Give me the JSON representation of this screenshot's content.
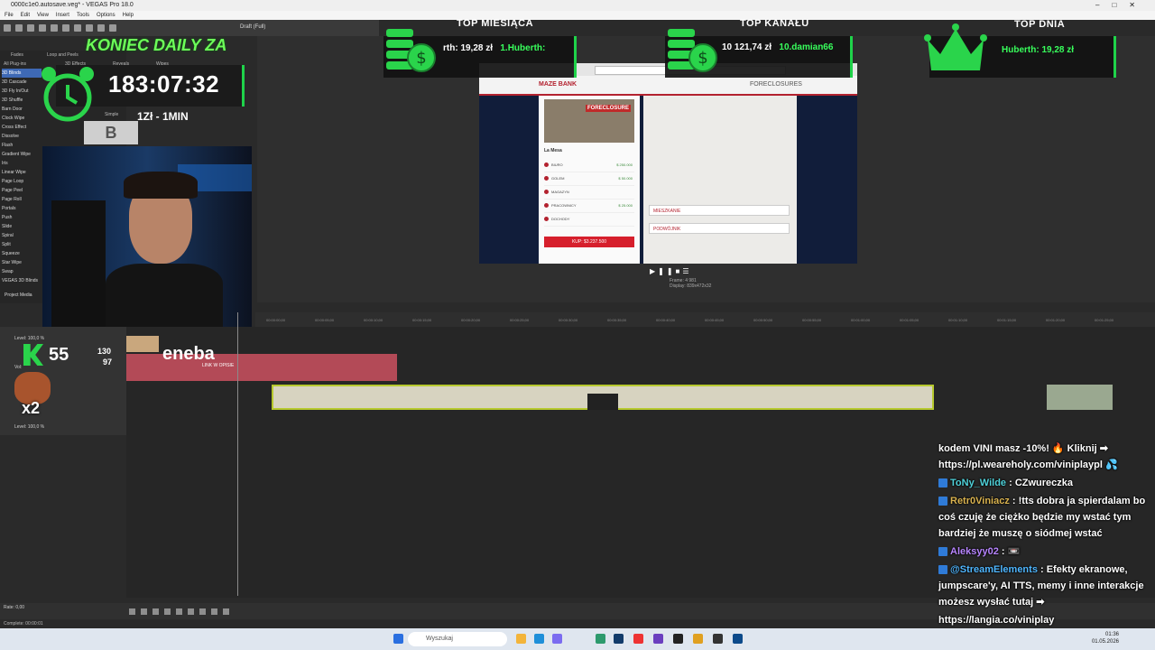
{
  "window": {
    "title": "0000c1e0.autosave.veg* - VEGAS Pro 18.0",
    "controls": [
      "–",
      "□",
      "✕"
    ]
  },
  "menu": [
    "File",
    "Edit",
    "View",
    "Insert",
    "Tools",
    "Options",
    "Help"
  ],
  "toolbar": {
    "preview_quality": "Draft (Full)"
  },
  "plugins": {
    "tabs": [
      "Fades",
      "Loop and Peels",
      "All Plug-ins",
      "3D Effects",
      "Reveals",
      "Wipes"
    ],
    "items": [
      "3D Blinds",
      "3D Cascade",
      "3D Fly In/Out",
      "3D Shuffle",
      "Barn Door",
      "Clock Wipe",
      "Cross Effect",
      "Dissolve",
      "Flash",
      "Gradient Wipe",
      "Iris",
      "Linear Wipe",
      "Page Loop",
      "Page Peel",
      "Page Roll",
      "Portals",
      "Push",
      "Slide",
      "Spiral",
      "Split",
      "Squeeze",
      "Star Wipe",
      "Swap",
      "VEGAS 3D Blinds"
    ],
    "selected": "3D Blinds",
    "preset_label": "Simple",
    "preset_letter": "B",
    "project_media": "Project Media"
  },
  "overlay": {
    "banners": [
      {
        "head": "TOP MIESIĄCA",
        "amount": "rth: 19,28 zł",
        "rank": "1.Huberth: "
      },
      {
        "head": "TOP KANAŁU",
        "amount": "10 121,74 zł",
        "rank": "10.damian66"
      },
      {
        "head": "TOP DNIA",
        "amount": "Huberth: 19,28 zł",
        "rank": ""
      }
    ],
    "daily_title": "KONIEC DAILY ZA",
    "timer": "183:07:32",
    "rate": "1Zł - 1MIN",
    "viewers": "55",
    "stats_top": "130",
    "stats_bottom": "97",
    "multiplier": "x2",
    "sponsor": "eneba",
    "sponsor_sub": "LINK W OPISIE",
    "accent": "#1fd34a"
  },
  "game": {
    "bank_name": "MAZE BANK",
    "section": "FORECLOSURES",
    "stamp": "FORECLOSURE",
    "list_title": "La Mesa",
    "options": [
      "BIURO",
      "GOLEM",
      "MAGAZYN",
      "PRACOWNICY",
      "DOCHODY"
    ],
    "prices": [
      "$ 250.000",
      "$ 50.000",
      "",
      "$ 25.000",
      ""
    ],
    "buy_button": "KUP: $3.237.500",
    "right_inputs": [
      "MIESZKANIE",
      "PODWÓJNIK"
    ]
  },
  "preview": {
    "frame_label": "Frame:",
    "frame_value": "4 981",
    "display_label": "Display:",
    "display_value": "839x472x32"
  },
  "timeline": {
    "ruler": [
      "00:00:00;00",
      "00:00:05;00",
      "00:00:10;00",
      "00:00:15;00",
      "00:00:20;00",
      "00:00:25;00",
      "00:00:30;00",
      "00:00:35;00",
      "00:00:40;00",
      "00:00:45;00",
      "00:00:50;00",
      "00:00:55;00",
      "00:01:00;00",
      "00:01:05;00",
      "00:01:10;00",
      "00:01:15;00",
      "00:01:20;00",
      "00:01:25;00"
    ],
    "levels": [
      "Level: 100,0 %",
      "Level: 100,0 %"
    ],
    "vol_label": "Vol:",
    "rate": "Rate: 0,00",
    "status": "Complete: 00:00:01"
  },
  "taskbar": {
    "search_placeholder": "Wyszukaj",
    "time": "01:36",
    "date": "01.05.2026"
  },
  "chat": [
    {
      "user": "",
      "color": "#ffffff",
      "text": "kodem VINI masz -10%! 🔥 Kliknij ➡ https://pl.weareholy.com/viniplaypl 💦"
    },
    {
      "user": "ToNy_Wilde",
      "color": "#4fd1d9",
      "text": ": CZwureczka"
    },
    {
      "user": "Retr0Viniacz",
      "color": "#d9b24f",
      "text": ": !tts dobra ja spierdalam bo coś czuję że ciężko będzie my wstać tym bardziej że muszę o siódmej wstać"
    },
    {
      "user": "Aleksyy02",
      "color": "#b785ff",
      "text": ": 📼"
    },
    {
      "user": "@StreamElements",
      "color": "#4fb6ff",
      "text": ": Efekty ekranowe, jumpscare'y, AI TTS, memy i inne interakcje możesz wysłać tutaj ➡"
    },
    {
      "user": "",
      "color": "#ffffff",
      "text": "https://langia.co/viniplay"
    }
  ]
}
